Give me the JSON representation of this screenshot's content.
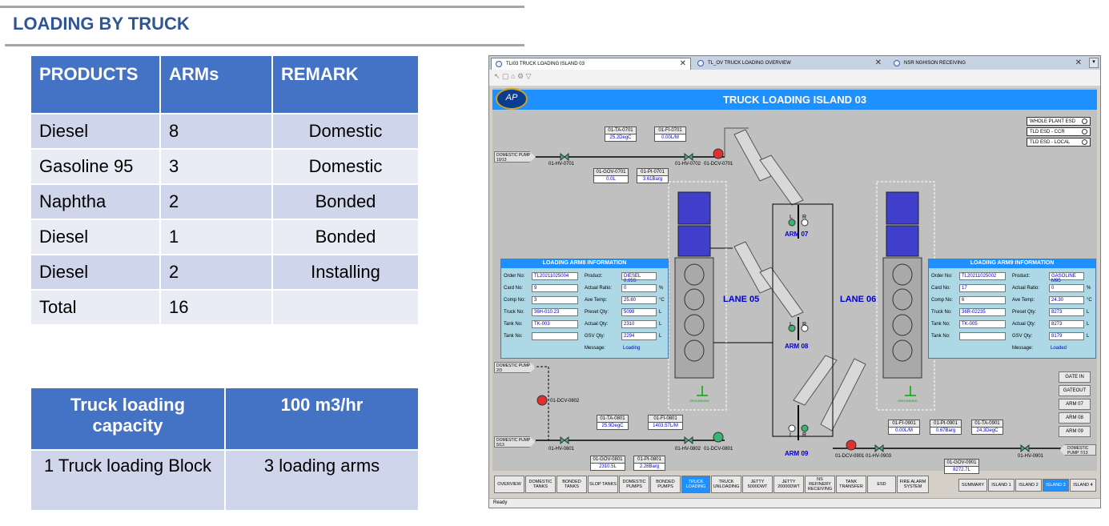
{
  "slide": {
    "title": "LOADING BY TRUCK"
  },
  "products_table": {
    "headers": [
      "PRODUCTS",
      "ARMs",
      "REMARK"
    ],
    "rows": [
      [
        "Diesel",
        "8",
        "Domestic"
      ],
      [
        "Gasoline 95",
        "3",
        "Domestic"
      ],
      [
        "Naphtha",
        "2",
        "Bonded"
      ],
      [
        "Diesel",
        "1",
        "Bonded"
      ],
      [
        "Diesel",
        "2",
        "Installing"
      ],
      [
        "Total",
        "16",
        ""
      ]
    ]
  },
  "capacity_table": {
    "headers": [
      "Truck loading capacity",
      "100 m3/hr"
    ],
    "row": [
      "1 Truck loading Block",
      "3 loading arms"
    ]
  },
  "window": {
    "tabs": [
      {
        "label": "TLI03 TRUCK LOADING ISLAND 03",
        "active": true
      },
      {
        "label": "TL_OV TRUCK LOADING OVERVIEW",
        "active": false
      },
      {
        "label": "NSR NGHISON RECEIVING",
        "active": false
      }
    ],
    "toolbar_text": "↖ ▢ ⌂ ⚙ ▽",
    "logo_text": "AP",
    "screen_title": "TRUCK LOADING ISLAND 03",
    "esd_buttons": [
      "WHOLE PLANT ESD",
      "TLD ESD - CCR",
      "TLD ESD - LOCAL"
    ],
    "pumps": {
      "top_left": "DOMESTIC PUMP 10/13",
      "mid_left": "DOMESTIC PUMP 2/3",
      "bottom_left": "DOMESTIC PUMP 5/13",
      "bottom_right": "DOMESTIC PUMP 7/13"
    },
    "tags_top": {
      "ta": {
        "name": "01-TA-0701",
        "value": "25.2DegC"
      },
      "fi": {
        "name": "01-FI-0701",
        "value": "0.00L/M"
      },
      "gov": {
        "name": "01-GOV-0701",
        "value": "0.0L"
      },
      "pi": {
        "name": "01-PI-0701",
        "value": "3.61Barg"
      }
    },
    "tags_bottom_left": {
      "ta": {
        "name": "01-TA-0801",
        "value": "25.9DegC"
      },
      "fi": {
        "name": "01-FI-0801",
        "value": "1403.57L/M"
      },
      "gov": {
        "name": "01-GOV-0801",
        "value": "2310.5L"
      },
      "pi": {
        "name": "01-PI-0801",
        "value": "2.28Barg"
      }
    },
    "tags_bottom_right": {
      "fi": {
        "name": "01-FI-0901",
        "value": "0.00L/M"
      },
      "pi": {
        "name": "01-PI-0901",
        "value": "0.67Barg"
      },
      "ta": {
        "name": "01-TA-0901",
        "value": "24.3DegC"
      },
      "gov": {
        "name": "01-GOV-0901",
        "value": "8272.7L"
      }
    },
    "valves": {
      "hv0701": "01-HV-0701",
      "hv0702": "01-HV-0702",
      "dcv0701": "01-DCV-0701",
      "dcv0802": "01-DCV-0802",
      "hv0801": "01-HV-0801",
      "hv0802": "01-HV-0802",
      "dcv0801": "01-DCV-0801",
      "dcv0901": "01-DCV-0901",
      "hv0903": "01-HV-0903",
      "hv0901": "01-HV-0901"
    },
    "arm8_panel": {
      "title": "LOADING ARM8  INFORMATION",
      "left": [
        {
          "label": "Order No:",
          "value": "TL20211025004"
        },
        {
          "label": "Card No:",
          "value": "9"
        },
        {
          "label": "Comp No:",
          "value": "3"
        },
        {
          "label": "Truck No:",
          "value": "36H-010.23"
        },
        {
          "label": "Tank No:",
          "value": "TK-003"
        },
        {
          "label": "Tank No:",
          "value": ""
        }
      ],
      "right": [
        {
          "label": "Product:",
          "value": "DIESEL 0.05S",
          "unit": ""
        },
        {
          "label": "Actual Ratio:",
          "value": "0",
          "unit": "%"
        },
        {
          "label": "Ave Temp:",
          "value": "25.60",
          "unit": "°C"
        },
        {
          "label": "Preset Qty:",
          "value": "5098",
          "unit": "L"
        },
        {
          "label": "Actual Qty:",
          "value": "2310",
          "unit": "L"
        },
        {
          "label": "GSV Qty:",
          "value": "2294",
          "unit": "L"
        }
      ],
      "message_label": "Message:",
      "message": "Loading"
    },
    "arm9_panel": {
      "title": "LOADING ARM9  INFORMATION",
      "left": [
        {
          "label": "Order No:",
          "value": "TL20211025002"
        },
        {
          "label": "Card No:",
          "value": "17"
        },
        {
          "label": "Comp No:",
          "value": "6"
        },
        {
          "label": "Truck No:",
          "value": "36R-02235"
        },
        {
          "label": "Tank No:",
          "value": "TK-005"
        },
        {
          "label": "Tank No:",
          "value": ""
        }
      ],
      "right": [
        {
          "label": "Product:",
          "value": "GASOLINE M95",
          "unit": ""
        },
        {
          "label": "Actual Ratio:",
          "value": "0",
          "unit": "%"
        },
        {
          "label": "Ave Temp:",
          "value": "24.30",
          "unit": "°C"
        },
        {
          "label": "Preset Qty:",
          "value": "8273",
          "unit": "L"
        },
        {
          "label": "Actual Qty:",
          "value": "8273",
          "unit": "L"
        },
        {
          "label": "GSV Qty:",
          "value": "8179",
          "unit": "L"
        }
      ],
      "message_label": "Message:",
      "message": "Loaded"
    },
    "lanes": [
      "LANE 05",
      "LANE 06"
    ],
    "arms": [
      "ARM 07",
      "ARM 08",
      "ARM 09"
    ],
    "lr": [
      "L",
      "R"
    ],
    "grounding": "GROUNDING",
    "side_buttons": [
      "GATE IN",
      "GATEOUT",
      "ARM 07",
      "ARM 08",
      "ARM 09"
    ],
    "nav_buttons": [
      {
        "label": "OVERVIEW",
        "active": false
      },
      {
        "label": "DOMESTIC TANKS",
        "active": false
      },
      {
        "label": "BONDED TANKS",
        "active": false
      },
      {
        "label": "SLOP TANKS",
        "active": false
      },
      {
        "label": "DOMESTIC PUMPS",
        "active": false
      },
      {
        "label": "BONDED PUMPS",
        "active": false
      },
      {
        "label": "TRUCK LOADING",
        "active": true
      },
      {
        "label": "TRUCK UNLOADING",
        "active": false
      },
      {
        "label": "JETTY 5000DWT",
        "active": false
      },
      {
        "label": "JETTY 20000DWT",
        "active": false
      },
      {
        "label": "NS REFINERY RECEIVING",
        "active": false
      },
      {
        "label": "TANK TRANSFER",
        "active": false
      },
      {
        "label": "ESD",
        "active": false
      },
      {
        "label": "FIRE ALARM SYSTEM",
        "active": false
      }
    ],
    "island_buttons": [
      {
        "label": "SUMMARY",
        "active": false
      },
      {
        "label": "ISLAND 1",
        "active": false
      },
      {
        "label": "ISLAND 2",
        "active": false
      },
      {
        "label": "ISLAND 3",
        "active": true
      },
      {
        "label": "ISLAND 4",
        "active": false
      }
    ],
    "status": "Ready",
    "colors": {
      "accent": "#1e90ff",
      "header": "#4472c4",
      "valve_open": "#3cb371",
      "valve_closed": "#e03030"
    }
  }
}
